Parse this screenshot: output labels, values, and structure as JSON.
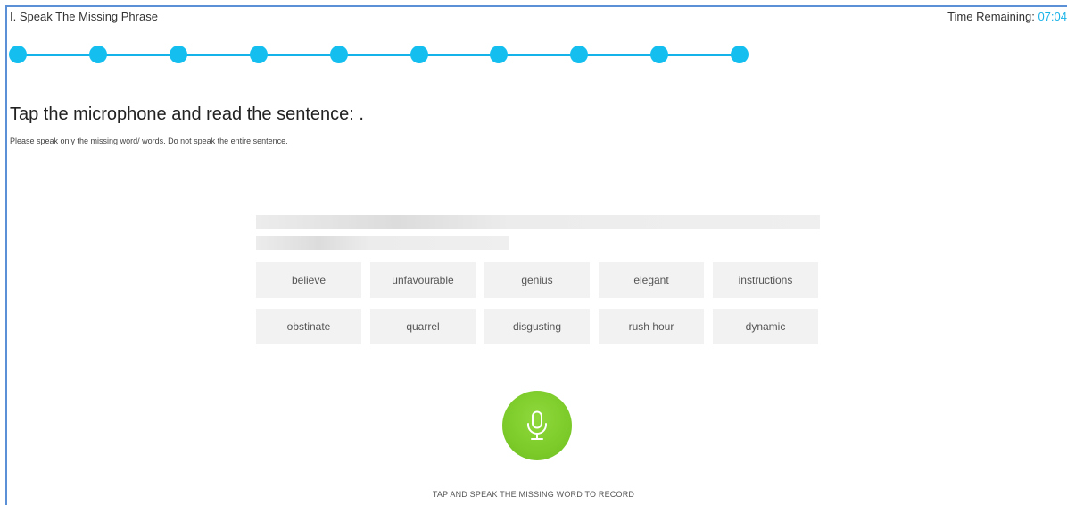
{
  "header": {
    "title": "I. Speak The Missing Phrase",
    "timer_label": "Time Remaining: ",
    "timer_value": "07:04"
  },
  "progress": {
    "total_steps": 10
  },
  "question": {
    "prompt": "Tap the microphone and read the sentence: .",
    "instruction": "Please speak only the missing word/ words. Do not speak the entire sentence."
  },
  "choices": [
    "believe",
    "unfavourable",
    "genius",
    "elegant",
    "instructions",
    "obstinate",
    "quarrel",
    "disgusting",
    "rush hour",
    "dynamic"
  ],
  "recorder": {
    "icon": "microphone-icon",
    "caption": "TAP AND SPEAK THE MISSING WORD TO RECORD"
  },
  "colors": {
    "accent": "#14bff0",
    "timer": "#1ab3e8",
    "mic": "#7ccb2a",
    "frame": "#5b8fd6"
  }
}
